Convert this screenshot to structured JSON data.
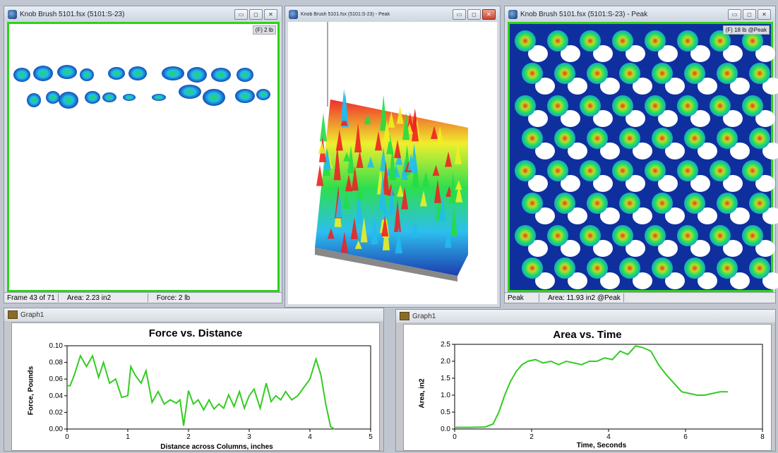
{
  "window_left": {
    "title": "Knob Brush 5101.fsx (5101:S-23)",
    "badge": "(F) 2 lb",
    "status": {
      "frame": "Frame 43 of 71",
      "area": "Area: 2.23 in2",
      "force": "Force: 2 lb"
    }
  },
  "window_middle": {
    "title": "Knob Brush 5101.fsx (5101:S-23) - Peak"
  },
  "window_right": {
    "title": "Knob Brush 5101.fsx (5101:S-23) - Peak",
    "badge": "(F) 18 lb @Peak",
    "status": {
      "mode": "Peak",
      "area": "Area: 11.93 in2 @Peak"
    }
  },
  "win_buttons": {
    "minimize": "▭",
    "maximize": "◻",
    "close": "✕"
  },
  "graph_left_window": {
    "title": "Graph1"
  },
  "graph_right_window": {
    "title": "Graph1"
  },
  "colors": {
    "series": "#33cc22",
    "frame_border": "#2fd11a"
  },
  "chart_data": [
    {
      "type": "line",
      "title": "Force vs. Distance",
      "xlabel": "Distance across Columns, inches",
      "ylabel": "Force, Pounds",
      "xlim": [
        0,
        5
      ],
      "ylim": [
        0,
        0.1
      ],
      "xticks": [
        "0",
        "1",
        "2",
        "3",
        "4",
        "5"
      ],
      "yticks": [
        "0.00",
        "0.02",
        "0.04",
        "0.06",
        "0.08",
        "0.10"
      ],
      "grid": false,
      "x": [
        0.0,
        0.05,
        0.12,
        0.22,
        0.32,
        0.42,
        0.52,
        0.6,
        0.7,
        0.8,
        0.9,
        1.0,
        1.05,
        1.12,
        1.22,
        1.3,
        1.4,
        1.5,
        1.6,
        1.7,
        1.8,
        1.86,
        1.92,
        2.0,
        2.08,
        2.16,
        2.25,
        2.34,
        2.42,
        2.5,
        2.58,
        2.66,
        2.75,
        2.84,
        2.92,
        3.0,
        3.08,
        3.18,
        3.28,
        3.36,
        3.44,
        3.52,
        3.6,
        3.7,
        3.8,
        3.9,
        4.0,
        4.1,
        4.18,
        4.26,
        4.34,
        4.4
      ],
      "y": [
        0.052,
        0.052,
        0.065,
        0.088,
        0.075,
        0.088,
        0.062,
        0.08,
        0.055,
        0.06,
        0.038,
        0.04,
        0.075,
        0.065,
        0.055,
        0.07,
        0.032,
        0.045,
        0.03,
        0.035,
        0.031,
        0.035,
        0.004,
        0.046,
        0.03,
        0.035,
        0.023,
        0.035,
        0.024,
        0.03,
        0.025,
        0.041,
        0.027,
        0.045,
        0.025,
        0.04,
        0.048,
        0.025,
        0.055,
        0.033,
        0.04,
        0.035,
        0.045,
        0.035,
        0.04,
        0.05,
        0.06,
        0.084,
        0.065,
        0.03,
        0.003,
        0.0
      ]
    },
    {
      "type": "line",
      "title": "Area vs. Time",
      "xlabel": "Time, Seconds",
      "ylabel": "Area, in2",
      "xlim": [
        0,
        8
      ],
      "ylim": [
        0,
        2.5
      ],
      "xticks": [
        "0",
        "2",
        "4",
        "6",
        "8"
      ],
      "yticks": [
        "0.0",
        "0.5",
        "1.0",
        "1.5",
        "2.0",
        "2.5"
      ],
      "grid": false,
      "x": [
        0,
        0.4,
        0.8,
        1.0,
        1.15,
        1.3,
        1.45,
        1.6,
        1.75,
        1.9,
        2.1,
        2.3,
        2.5,
        2.7,
        2.9,
        3.1,
        3.3,
        3.5,
        3.7,
        3.9,
        4.1,
        4.3,
        4.5,
        4.7,
        4.9,
        5.1,
        5.3,
        5.5,
        5.7,
        5.9,
        6.1,
        6.3,
        6.5,
        6.7,
        6.9,
        7.1
      ],
      "y": [
        0.05,
        0.05,
        0.06,
        0.15,
        0.5,
        1.0,
        1.4,
        1.7,
        1.9,
        2.0,
        2.05,
        1.95,
        2.0,
        1.9,
        2.0,
        1.95,
        1.9,
        2.0,
        2.0,
        2.1,
        2.05,
        2.3,
        2.2,
        2.45,
        2.4,
        2.3,
        1.9,
        1.6,
        1.35,
        1.1,
        1.05,
        1.0,
        1.0,
        1.05,
        1.1,
        1.1
      ]
    }
  ]
}
